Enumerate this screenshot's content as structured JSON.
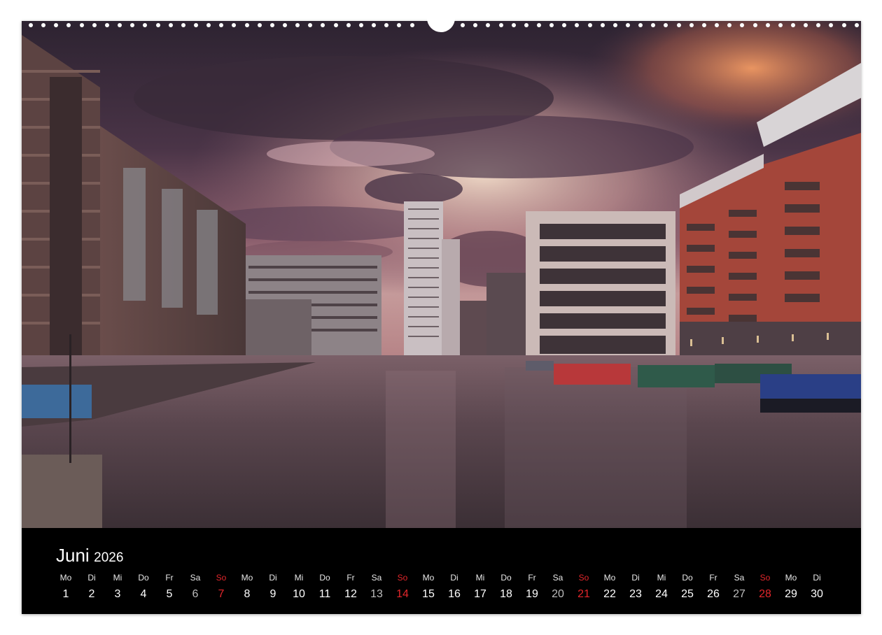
{
  "calendar": {
    "month": "Juni",
    "year": "2026",
    "colors": {
      "sunday": "#e3262b",
      "saturday": "#bdbdbd",
      "weekday": "#ffffff",
      "background": "#000000"
    },
    "days": [
      {
        "wd": "Mo",
        "d": "1"
      },
      {
        "wd": "Di",
        "d": "2"
      },
      {
        "wd": "Mi",
        "d": "3"
      },
      {
        "wd": "Do",
        "d": "4"
      },
      {
        "wd": "Fr",
        "d": "5"
      },
      {
        "wd": "Sa",
        "d": "6"
      },
      {
        "wd": "So",
        "d": "7"
      },
      {
        "wd": "Mo",
        "d": "8"
      },
      {
        "wd": "Di",
        "d": "9"
      },
      {
        "wd": "Mi",
        "d": "10"
      },
      {
        "wd": "Do",
        "d": "11"
      },
      {
        "wd": "Fr",
        "d": "12"
      },
      {
        "wd": "Sa",
        "d": "13"
      },
      {
        "wd": "So",
        "d": "14"
      },
      {
        "wd": "Mo",
        "d": "15"
      },
      {
        "wd": "Di",
        "d": "16"
      },
      {
        "wd": "Mi",
        "d": "17"
      },
      {
        "wd": "Do",
        "d": "18"
      },
      {
        "wd": "Fr",
        "d": "19"
      },
      {
        "wd": "Sa",
        "d": "20"
      },
      {
        "wd": "So",
        "d": "21"
      },
      {
        "wd": "Mo",
        "d": "22"
      },
      {
        "wd": "Di",
        "d": "23"
      },
      {
        "wd": "Mi",
        "d": "24"
      },
      {
        "wd": "Do",
        "d": "25"
      },
      {
        "wd": "Fr",
        "d": "26"
      },
      {
        "wd": "Sa",
        "d": "27"
      },
      {
        "wd": "So",
        "d": "28"
      },
      {
        "wd": "Mo",
        "d": "29"
      },
      {
        "wd": "Di",
        "d": "30"
      }
    ]
  },
  "photo": {
    "colors": {
      "sky_top": "#3a2a3c",
      "cloud": "#5a3f55",
      "glow": "#f1c7a7",
      "orange_glow": "#e3865a",
      "water": "#5b4750",
      "brick": "#b8483a"
    }
  }
}
